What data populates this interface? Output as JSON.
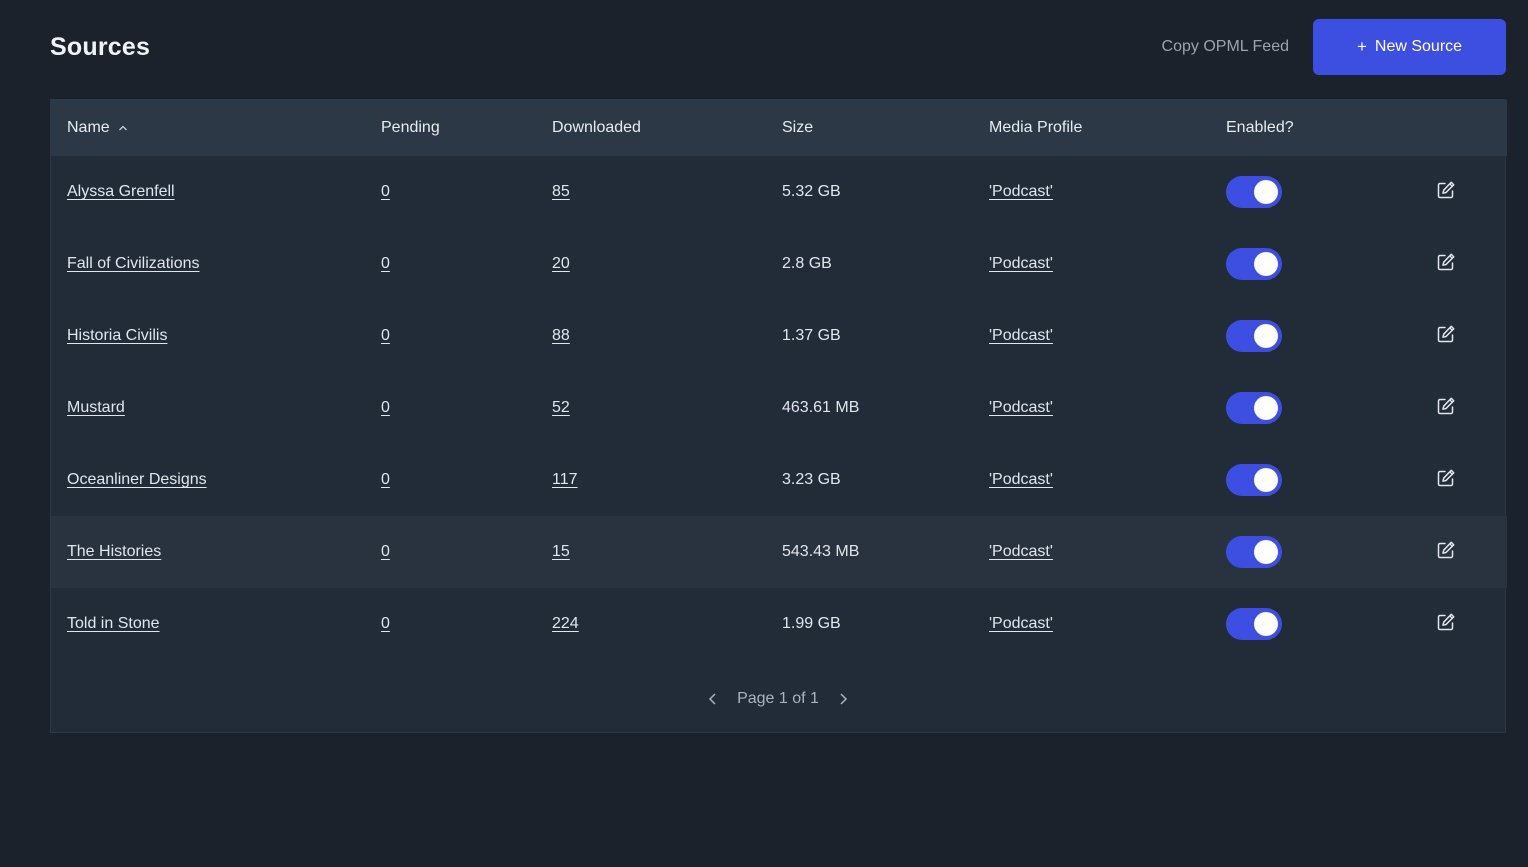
{
  "header": {
    "title": "Sources",
    "copy_opml_label": "Copy OPML Feed",
    "new_source_plus": "+",
    "new_source_label": "New Source"
  },
  "table": {
    "columns": {
      "name": "Name",
      "pending": "Pending",
      "downloaded": "Downloaded",
      "size": "Size",
      "media_profile": "Media Profile",
      "enabled": "Enabled?"
    },
    "sort": {
      "column": "Name",
      "direction": "ascending"
    },
    "rows": [
      {
        "name": "Alyssa Grenfell",
        "pending": "0",
        "downloaded": "85",
        "size": "5.32 GB",
        "media_profile": "'Podcast'",
        "enabled": true
      },
      {
        "name": "Fall of Civilizations",
        "pending": "0",
        "downloaded": "20",
        "size": "2.8 GB",
        "media_profile": "'Podcast'",
        "enabled": true
      },
      {
        "name": "Historia Civilis",
        "pending": "0",
        "downloaded": "88",
        "size": "1.37 GB",
        "media_profile": "'Podcast'",
        "enabled": true
      },
      {
        "name": "Mustard",
        "pending": "0",
        "downloaded": "52",
        "size": "463.61 MB",
        "media_profile": "'Podcast'",
        "enabled": true
      },
      {
        "name": "Oceanliner Designs",
        "pending": "0",
        "downloaded": "117",
        "size": "3.23 GB",
        "media_profile": "'Podcast'",
        "enabled": true
      },
      {
        "name": "The Histories",
        "pending": "0",
        "downloaded": "15",
        "size": "543.43 MB",
        "media_profile": "'Podcast'",
        "enabled": true
      },
      {
        "name": "Told in Stone",
        "pending": "0",
        "downloaded": "224",
        "size": "1.99 GB",
        "media_profile": "'Podcast'",
        "enabled": true
      }
    ]
  },
  "pagination": {
    "label": "Page 1 of 1"
  },
  "icons": {
    "sort": "chevron-up-icon",
    "edit": "edit-icon",
    "prev": "chevron-left-icon",
    "next": "chevron-right-icon"
  },
  "colors": {
    "background": "#1c222c",
    "table_background": "#222b38",
    "header_row": "#2d3846",
    "accent": "#3d4fe0"
  }
}
